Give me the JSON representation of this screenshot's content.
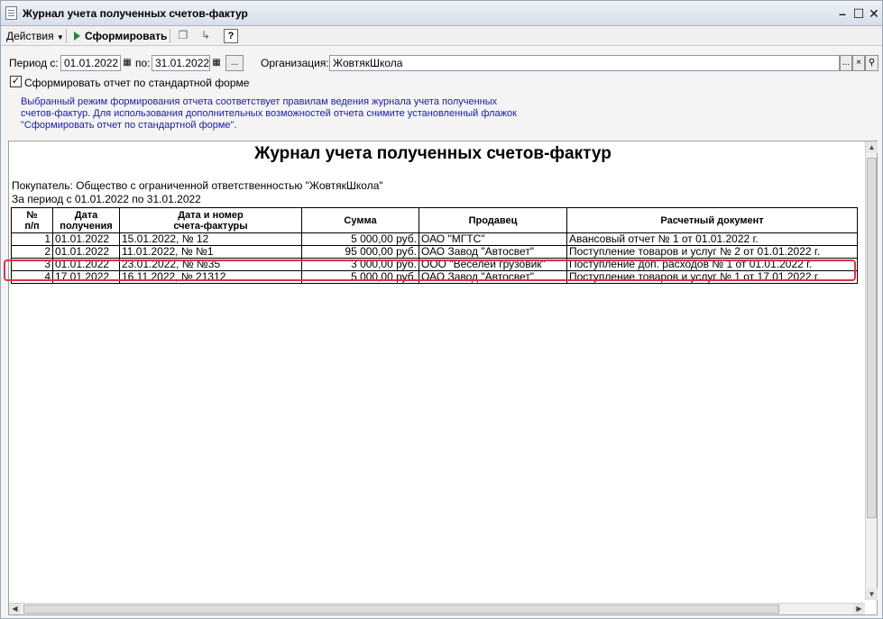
{
  "window": {
    "title": "Журнал учета полученных счетов-фактур"
  },
  "toolbar": {
    "actions_label": "Действия",
    "generate_label": "Сформировать",
    "help_label": "?"
  },
  "form": {
    "period_from_label": "Период с:",
    "period_from_value": "01.01.2022",
    "period_to_label": "по:",
    "period_to_value": "31.01.2022",
    "period_select_label": "...",
    "organization_label": "Организация:",
    "organization_value": "ЖовтякШкола",
    "org_select_label": "...",
    "standard_form_checkbox_label": "Сформировать отчет по стандартной форме",
    "standard_form_checked": true,
    "info_lines": [
      "Выбранный режим формирования отчета соответствует правилам ведения журнала учета полученных",
      "счетов-фактур. Для использования дополнительных возможностей отчета снимите установленный флажок",
      "\"Сформировать отчет по стандартной форме\"."
    ]
  },
  "report": {
    "title": "Журнал учета полученных счетов-фактур",
    "buyer_line": "Покупатель:  Общество с ограниченной ответственностью \"ЖовтякШкола\"",
    "period_line": "За период с 01.01.2022 по 31.01.2022",
    "headers": {
      "num_line1": "№",
      "num_line2": "п/п",
      "received_line1": "Дата",
      "received_line2": "получения",
      "invoice_line1": "Дата и номер",
      "invoice_line2": "счета-фактуры",
      "amount": "Сумма",
      "seller": "Продавец",
      "settlement": "Расчетный документ"
    },
    "rows": [
      {
        "num": "1",
        "received": "01.01.2022",
        "invoice": "15.01.2022, № 12",
        "amount": "5 000,00 руб.",
        "seller": "ОАО \"МГТС\"",
        "settlement": "Авансовый отчет № 1 от 01.01.2022 г."
      },
      {
        "num": "2",
        "received": "01.01.2022",
        "invoice": "11.01.2022, № №1",
        "amount": "95 000,00 руб.",
        "seller": "ОАО Завод \"Автосвет\"",
        "settlement": "Поступление товаров и услуг № 2 от 01.01.2022 г."
      },
      {
        "num": "3",
        "received": "01.01.2022",
        "invoice": "23.01.2022, № №35",
        "amount": "3 000,00 руб.",
        "seller": "ООО \"Веселей грузовик\"",
        "settlement": "Поступление доп. расходов № 1 от 01.01.2022 г."
      },
      {
        "num": "4",
        "received": "17.01.2022",
        "invoice": "16.11.2022, № 21312",
        "amount": "5 000,00 руб.",
        "seller": "ОАО Завод \"Автосвет\"",
        "settlement": "Поступление товаров и услуг № 1 от 17.01.2022 г."
      }
    ]
  },
  "icons": [
    "document-icon",
    "minimize-icon",
    "maximize-icon",
    "close-icon",
    "play-icon",
    "calendar-icon",
    "search-icon"
  ],
  "colors": {
    "highlight": "#d9363e",
    "info_text": "#1a1aa6",
    "play": "#1d8a2e"
  }
}
